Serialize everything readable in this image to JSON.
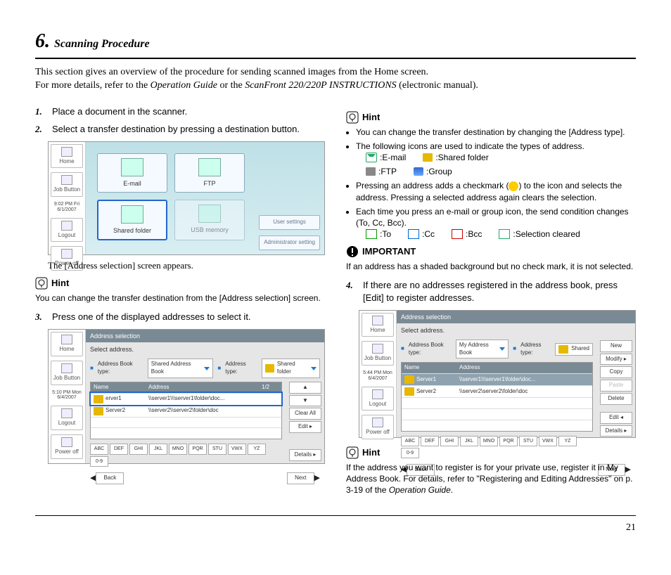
{
  "heading": {
    "num": "6.",
    "title": "Scanning Procedure"
  },
  "intro": {
    "l1": "This section gives an overview of the procedure for sending scanned images from the Home screen.",
    "l2a": "For more details, refer to the ",
    "l2b": "Operation Guide",
    "l2c": " or the ",
    "l2d": "ScanFront 220/220P INSTRUCTIONS",
    "l2e": " (electronic manual)."
  },
  "steps": {
    "s1": "Place a document in the scanner.",
    "s2": "Select a transfer destination by pressing a destination button.",
    "s3": "Press one of the displayed addresses to select it.",
    "s4": "If there are no addresses registered in the address book, press [Edit] to register addresses."
  },
  "fig1cap": "The [Address selection] screen appears.",
  "hint": {
    "label": "Hint",
    "h1": "You can change the transfer destination from the [Address selection] screen.",
    "h2a": "You can change the transfer destination by changing the [Address type].",
    "h2b": "The following icons are used to indicate the types of address.",
    "h2c": "Pressing an address adds a checkmark (",
    "h2c2": ") to the icon and selects the address. Pressing a selected address again clears the selection.",
    "h2d": "Each time you press an e-mail or group icon, the send condition changes (To, Cc, Bcc).",
    "h3": "If the address you want to register is for your private use, register it in My Address Book. For details, refer to \"Registering and Editing Addresses\" on p. 3-19 of the ",
    "h3b": "Operation Guide",
    "h3c": "."
  },
  "icons": {
    "email": ":E-mail",
    "shared": ":Shared folder",
    "ftp": ":FTP",
    "group": ":Group",
    "to": ":To",
    "cc": ":Cc",
    "bcc": ":Bcc",
    "sel": ":Selection cleared"
  },
  "important": {
    "label": "IMPORTANT",
    "text": "If an address has a shaded background but no check mark, it is not selected."
  },
  "fig1": {
    "home": "Home",
    "job": "Job Button",
    "time": "9:02 PM  Fri\n6/1/2007",
    "logout": "Logout",
    "power": "Power off",
    "email": "E-mail",
    "ftp": "FTP",
    "shared": "Shared folder",
    "usb": "USB memory",
    "user": "User settings",
    "admin": "Administrator setting"
  },
  "fig2": {
    "time": "5:10 PM  Mon\n6/4/2007",
    "title": "Address selection",
    "sub": "Select address.",
    "ablabel": "Address Book type:",
    "abval": "Shared Address Book",
    "atlabel": "Address type:",
    "atval": "Shared folder",
    "nameh": "Name",
    "addrh": "Address",
    "pg": "1/2",
    "r1n": "erver1",
    "r1a": "\\\\server1\\\\\\server1\\folder\\doc...",
    "r2n": "Server2",
    "r2a": "\\\\server2\\\\server2\\folder\\doc",
    "clear": "Clear All",
    "edit": "Edit",
    "details": "Details",
    "back": "Back",
    "next": "Next",
    "keys": [
      "ABC",
      "DEF",
      "GHI",
      "JKL",
      "MNO",
      "PQR",
      "STU",
      "VWX",
      "YZ",
      "0-9"
    ]
  },
  "fig3": {
    "time": "5:44 PM  Mon\n6/4/2007",
    "abval": "My Address Book",
    "atval": "Shared",
    "r1n": "Server1",
    "r1a": "\\\\server1\\\\\\server1\\folder\\doc...",
    "r2n": "Server2",
    "r2a": "\\\\server2\\server2\\folder\\doc",
    "new": "New",
    "modify": "Modify",
    "copy": "Copy",
    "paste": "Paste",
    "delete": "Delete",
    "edit": "Edit",
    "details": "Details"
  },
  "page": "21"
}
